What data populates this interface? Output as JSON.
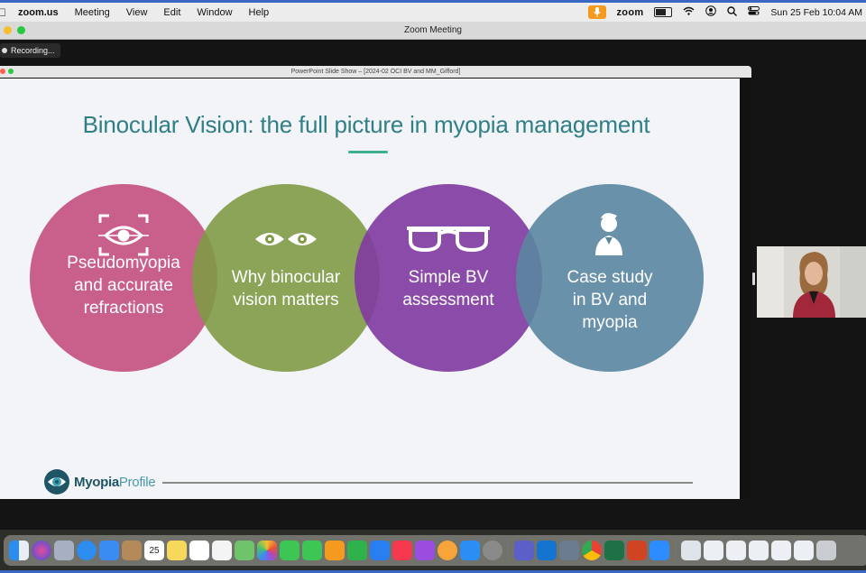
{
  "menubar": {
    "app_name": "zoom.us",
    "menus": [
      "Meeting",
      "View",
      "Edit",
      "Window",
      "Help"
    ],
    "zoom_word": "zoom",
    "datetime": "Sun 25 Feb  10:04 AM"
  },
  "zoom_window": {
    "title": "Zoom Meeting",
    "recording_label": "Recording..."
  },
  "ppt_window": {
    "title": "PowerPoint Slide Show – [2024-02 OCI BV and MM_Gifford]"
  },
  "slide": {
    "title": "Binocular Vision: the full picture in myopia management",
    "circles": [
      {
        "label": "Pseudomyopia and accurate refractions",
        "lines": [
          "Pseudomyopia",
          "and accurate",
          "refractions"
        ],
        "color": "#c44f7e",
        "icon": "eye-scan-icon"
      },
      {
        "label": "Why binocular vision matters",
        "lines": [
          "Why binocular",
          "vision matters"
        ],
        "color": "#7f9b45",
        "icon": "two-eyes-icon"
      },
      {
        "label": "Simple BV assessment",
        "lines": [
          "Simple BV",
          "assessment"
        ],
        "color": "#7f3aa0",
        "icon": "glasses-icon"
      },
      {
        "label": "Case study in BV and myopia",
        "lines": [
          "Case study",
          "in BV and",
          "myopia"
        ],
        "color": "#5a86a0",
        "icon": "person-icon"
      }
    ],
    "logo": {
      "part1": "Myopia",
      "part2": "Profile"
    },
    "colors": {
      "title": "#2f7f87",
      "accent_underline": "#3caf8d"
    }
  },
  "dock": {
    "icons": [
      "finder-icon",
      "siri-icon",
      "launchpad-icon",
      "safari-icon",
      "mail-icon",
      "contacts-icon",
      "calendar-icon",
      "notes-icon",
      "freeform-icon",
      "reminders-icon",
      "maps-icon",
      "photos-icon",
      "messages-icon",
      "facetime-icon",
      "pages-icon",
      "numbers-icon",
      "keynote-icon",
      "music-icon",
      "podcasts-icon",
      "flower-icon",
      "appstore-icon",
      "settings-icon",
      "teams-icon",
      "outlook-icon",
      "preview-icon",
      "chrome-icon",
      "excel-icon",
      "powerpoint-icon",
      "zoom-icon",
      "downloads-icon",
      "doc1-icon",
      "doc2-icon",
      "doc3-icon",
      "doc4-icon",
      "doc5-icon",
      "trash-icon"
    ],
    "calendar_day": "25"
  }
}
